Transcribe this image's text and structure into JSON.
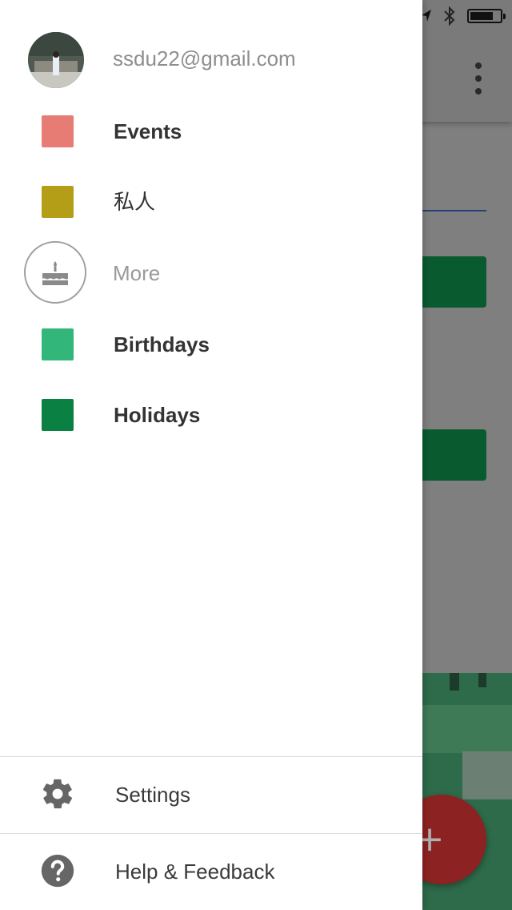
{
  "status_bar": {
    "icons": [
      "location-arrow-icon",
      "bluetooth-icon",
      "battery-icon"
    ],
    "battery_level": 0.8
  },
  "account": {
    "email": "ssdu22@gmail.com"
  },
  "calendars": [
    {
      "label": "Events",
      "color": "#e67c73",
      "bold": true
    },
    {
      "label": "私人",
      "color": "#b49e17",
      "bold": false
    }
  ],
  "more": {
    "label": "More",
    "icon": "birthday-cake-icon"
  },
  "more_calendars": [
    {
      "label": "Birthdays",
      "color": "#33b679",
      "bold": true
    },
    {
      "label": "Holidays",
      "color": "#0b8043",
      "bold": true
    }
  ],
  "footer": {
    "settings_label": "Settings",
    "help_label": "Help & Feedback"
  },
  "fab": {
    "label": "+",
    "color": "#d23f31"
  }
}
